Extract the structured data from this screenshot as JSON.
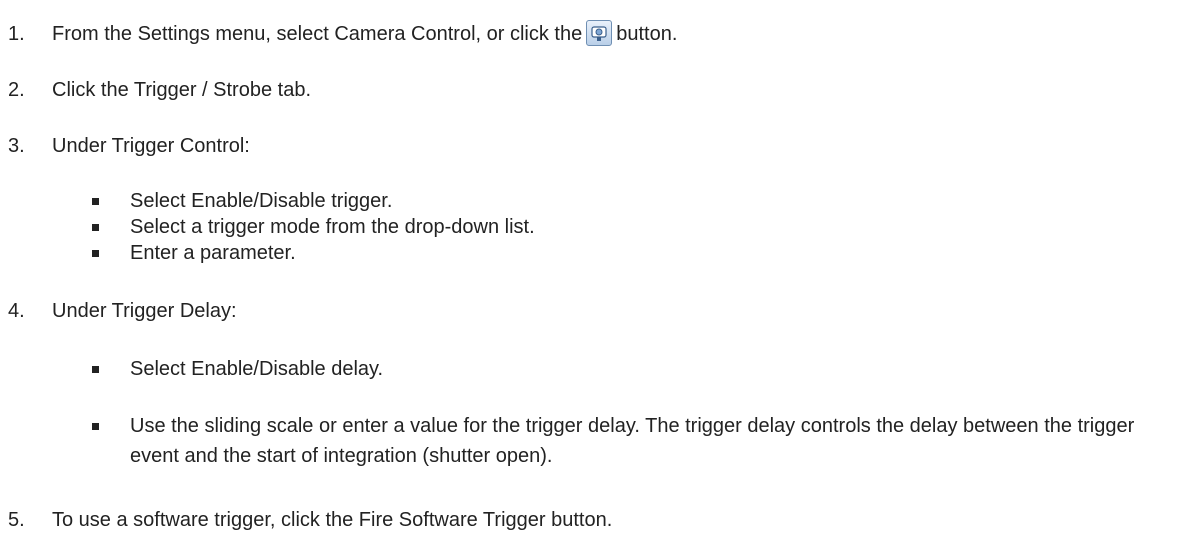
{
  "steps": [
    {
      "number": "1.",
      "text_before": "From the Settings menu, select Camera Control, or click the",
      "icon": "camera-control-icon",
      "text_after": "button."
    },
    {
      "number": "2.",
      "text": "Click the Trigger / Strobe tab."
    },
    {
      "number": "3.",
      "text": "Under Trigger Control:"
    },
    {
      "number": "4.",
      "text": "Under Trigger Delay:"
    },
    {
      "number": "5.",
      "text": "To use a software trigger, click the Fire Software Trigger button."
    }
  ],
  "trigger_control_bullets": [
    "Select Enable/Disable trigger.",
    "Select a trigger mode from the drop-down list.",
    "Enter a parameter."
  ],
  "trigger_delay_bullets": [
    "Select Enable/Disable delay.",
    "Use the sliding scale or enter a value for the trigger delay. The trigger delay controls the delay between the trigger event and the start of integration (shutter open)."
  ]
}
